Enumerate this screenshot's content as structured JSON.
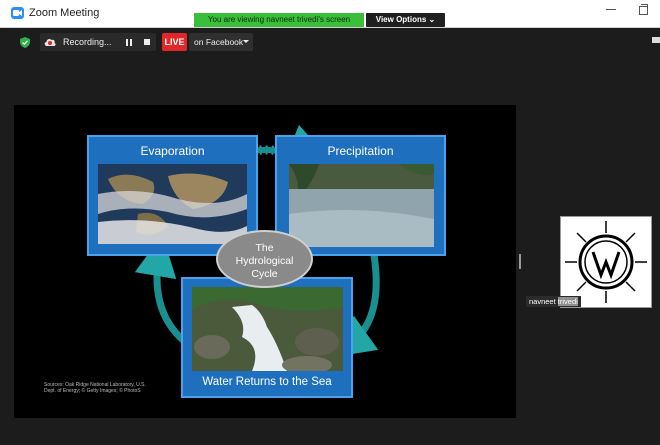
{
  "window": {
    "title": "Zoom Meeting",
    "viewing_banner": "You are viewing navneet trivedi's screen",
    "view_options_label": "View Options",
    "view_options_icon": "chevron-down-icon"
  },
  "toolbar": {
    "recording_label": "Recording...",
    "live_label": "LIVE",
    "stream_target": "on Facebook",
    "accent": "#e02828"
  },
  "slide": {
    "evaporation": "Evaporation",
    "precipitation": "Precipitation",
    "center_line1": "The",
    "center_line2": "Hydrological",
    "center_line3": "Cycle",
    "water_returns": "Water Returns to the Sea",
    "sources_line1": "Sources: Oak Ridge National Laboratory, U.S.",
    "sources_line2": "Dept. of Energy; © Getty Images; © PhotoS",
    "panel_color": "#1f6fbf",
    "arrow_color": "#22a6a6"
  },
  "participant": {
    "name_first": "navneet",
    "name_last": "trivedi"
  }
}
